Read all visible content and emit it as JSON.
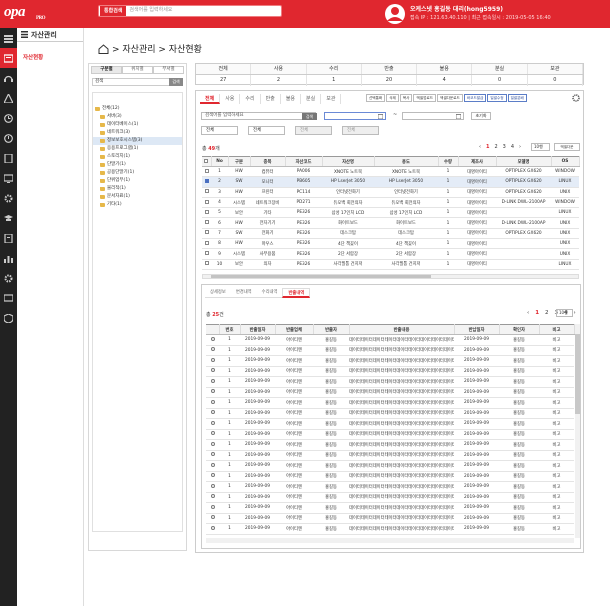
{
  "topbar": {
    "logo": "opa",
    "logo_sub": "PRO",
    "search_label": "통합검색",
    "search_placeholder": "검색어를 입력하세요",
    "user_name": "오케스넷 홍길동 대리(hong5959)",
    "user_info": "접속 IP : 121.63.40.110  |  최근 접속일시 : 2019-05-05 16:40"
  },
  "sidenav": {
    "title": "자산관리",
    "item": "자산현황"
  },
  "breadcrumb": "> 자산관리 > 자산현황",
  "tree": {
    "tabs": [
      "구분별",
      "위치별",
      "부서별"
    ],
    "search_value": "검색",
    "search_btn": "검색",
    "nodes": [
      {
        "label": "전체(12)",
        "depth": 0,
        "sel": false
      },
      {
        "label": "서버(3)",
        "depth": 1,
        "sel": false
      },
      {
        "label": "데이터베이스(1)",
        "depth": 1,
        "sel": false
      },
      {
        "label": "네트워크(3)",
        "depth": 1,
        "sel": false
      },
      {
        "label": "정보보호시스템(3)",
        "depth": 1,
        "sel": true
      },
      {
        "label": "응용프로그램(1)",
        "depth": 1,
        "sel": false
      },
      {
        "label": "스토리지(1)",
        "depth": 1,
        "sel": false
      },
      {
        "label": "단말기(1)",
        "depth": 1,
        "sel": false
      },
      {
        "label": "공용단말기(1)",
        "depth": 1,
        "sel": false
      },
      {
        "label": "단위업무(1)",
        "depth": 1,
        "sel": false
      },
      {
        "label": "물리적(1)",
        "depth": 1,
        "sel": false
      },
      {
        "label": "문서자료(1)",
        "depth": 1,
        "sel": false
      },
      {
        "label": "기타(1)",
        "depth": 1,
        "sel": false
      }
    ]
  },
  "stats": {
    "headers": [
      "전체",
      "사용",
      "수리",
      "반출",
      "불용",
      "분실",
      "보관"
    ],
    "values": [
      "27",
      "2",
      "1",
      "20",
      "4",
      "0",
      "0"
    ]
  },
  "main_tabs": [
    "전체",
    "사용",
    "수리",
    "반출",
    "불용",
    "분실",
    "보관"
  ],
  "actions": [
    "선택통화",
    "삭제",
    "복사",
    "엑셀업로드",
    "엑셀다운로드",
    "바코드발급",
    "일괄수정",
    "일괄분배"
  ],
  "filter": {
    "search_placeholder": "검색어를 입력하세요",
    "search_btn": "검색",
    "reset_btn": "초기화",
    "selects": [
      "전체",
      "전체",
      "전체",
      "전체"
    ]
  },
  "asset_list": {
    "count_prefix": "총 ",
    "count": "49",
    "count_suffix": "개",
    "pages": [
      "1",
      "2",
      "3",
      "4"
    ],
    "perpage": "10행",
    "export": "엑셀다운",
    "headers": [
      "No",
      "구분",
      "종목",
      "자산코드",
      "자산명",
      "용도",
      "수량",
      "제조사",
      "모델명",
      "OS"
    ],
    "rows": [
      [
        "1",
        "HW",
        "컴퓨터",
        "PA006",
        "XNOTE 노트북",
        "XNOTE 노트북",
        "1",
        "대명아이티",
        "OPTIPLEX GX620",
        "WINDOW"
      ],
      [
        "2",
        "SW",
        "모니터",
        "PB605",
        "HP LserJet 3050",
        "HP LserJet 3050",
        "1",
        "대명아이티",
        "OPTIPLEX GX620",
        "LINUX"
      ],
      [
        "3",
        "HW",
        "프린터",
        "PC114",
        "인터넷전화기",
        "인터넷전화기",
        "1",
        "대명아이티",
        "OPTIPLEX GX620",
        "UNIX"
      ],
      [
        "4",
        "시스템",
        "네트워크장비",
        "PD271",
        "듀오백 회전의자",
        "듀오백 회전의자",
        "1",
        "대명아이티",
        "D-LINK DWL-2100AP",
        "WINDOW"
      ],
      [
        "5",
        "보안",
        "기타",
        "PE326",
        "삼성 17인치 LCD",
        "삼성 17인치 LCD",
        "1",
        "대명아이티",
        "",
        "LINUX"
      ],
      [
        "6",
        "HW",
        "전자기기",
        "PE326",
        "화이트보드",
        "화이트보드",
        "1",
        "대명아이티",
        "D-LINK DWL-2100AP",
        "UNIX"
      ],
      [
        "7",
        "SW",
        "전화기",
        "PE326",
        "데스크탑",
        "데스크탑",
        "1",
        "대명아이티",
        "OPTIPLEX GX620",
        "UNIX"
      ],
      [
        "8",
        "HW",
        "마우스",
        "PE326",
        "4단 책꽂이",
        "4단 책꽂이",
        "1",
        "대명아이티",
        "",
        "UNIX"
      ],
      [
        "9",
        "시스템",
        "사무용품",
        "PE326",
        "2단 서랍장",
        "2단 서랍장",
        "1",
        "대명아이티",
        "",
        "UNIX"
      ],
      [
        "10",
        "보안",
        "의자",
        "PE326",
        "사각필통 건지저",
        "사각필통 건지저",
        "1",
        "대명아이티",
        "",
        "LINUX"
      ]
    ]
  },
  "sub_tabs": [
    "상세정보",
    "변경내역",
    "수리내역",
    "반출내역"
  ],
  "return_list": {
    "count_prefix": "총 ",
    "count": "25",
    "count_suffix": "건",
    "pages": [
      "1",
      "2",
      "3",
      "4"
    ],
    "perpage": "10행",
    "headers": [
      "번호",
      "반출일자",
      "반출업체",
      "반출자",
      "반출내용",
      "반납일자",
      "확인자",
      "비고"
    ],
    "row": [
      "1",
      "2019-09-09",
      "아이티엔",
      "홍길동",
      "데이터테이터데이터테이터데이터테이터데이터테이터데이터테이터",
      "2019-09-09",
      "홍길동",
      "비고"
    ],
    "row_count": 19
  }
}
